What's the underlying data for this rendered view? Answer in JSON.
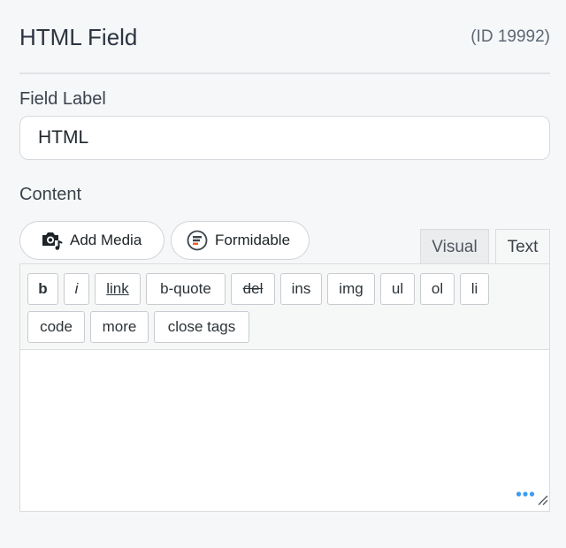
{
  "header": {
    "title": "HTML Field",
    "field_id": "(ID 19992)"
  },
  "field_label": {
    "label": "Field Label",
    "value": "HTML"
  },
  "content": {
    "label": "Content"
  },
  "media_buttons": {
    "add_media": {
      "label": "Add Media",
      "icon": "camera-music-icon"
    },
    "formidable": {
      "label": "Formidable",
      "icon": "formidable-logo-icon"
    }
  },
  "editor_tabs": {
    "visual": "Visual",
    "text": "Text"
  },
  "quicktags": [
    {
      "label": "b"
    },
    {
      "label": "i"
    },
    {
      "label": "link"
    },
    {
      "label": "b-quote"
    },
    {
      "label": "del"
    },
    {
      "label": "ins"
    },
    {
      "label": "img"
    },
    {
      "label": "ul"
    },
    {
      "label": "ol"
    },
    {
      "label": "li"
    },
    {
      "label": "code"
    },
    {
      "label": "more"
    },
    {
      "label": "close tags"
    }
  ],
  "editor": {
    "value": ""
  },
  "colors": {
    "accent_blue": "#3b9cf0",
    "formidable_orange": "#f05a24"
  }
}
